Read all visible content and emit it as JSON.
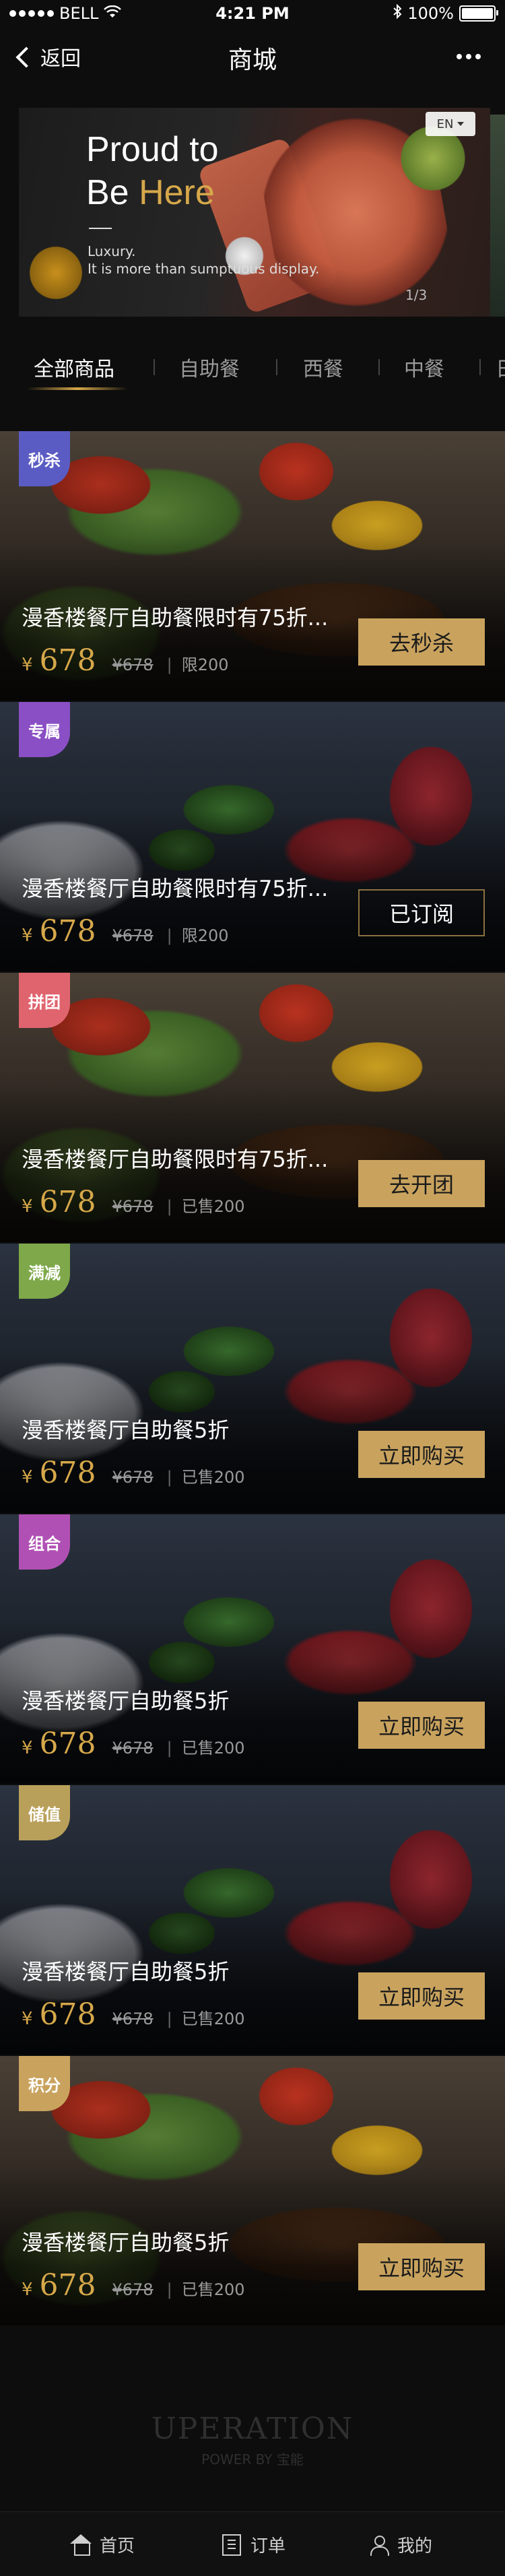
{
  "status_bar": {
    "carrier": "BELL",
    "time": "4:21 PM",
    "battery": "100%"
  },
  "nav": {
    "back_label": "返回",
    "title": "商城"
  },
  "banner": {
    "line1": "Proud to",
    "line2_a": "Be ",
    "line2_b": "Here",
    "sub1": "Luxury.",
    "sub2": "It is more than sumptuous display.",
    "pager": "1/3",
    "language": "EN"
  },
  "tabs": [
    "全部商品",
    "自助餐",
    "西餐",
    "中餐",
    "日"
  ],
  "products": [
    {
      "badge": "秒杀",
      "badge_color": "#5b5bc4",
      "name": "漫香楼餐厅自助餐限时有75折...",
      "currency": "¥",
      "price": "678",
      "original": "¥678",
      "info": "限200",
      "button": "去秒杀",
      "button_style": "filled",
      "image": "salad"
    },
    {
      "badge": "专属",
      "badge_color": "#8a4fc4",
      "name": "漫香楼餐厅自助餐限时有75折...",
      "currency": "¥",
      "price": "678",
      "original": "¥678",
      "info": "限200",
      "button": "已订阅",
      "button_style": "outline",
      "image": "lobster"
    },
    {
      "badge": "拼团",
      "badge_color": "#e0646e",
      "name": "漫香楼餐厅自助餐限时有75折...",
      "currency": "¥",
      "price": "678",
      "original": "¥678",
      "info": "已售200",
      "button": "去开团",
      "button_style": "filled",
      "image": "salad"
    },
    {
      "badge": "满减",
      "badge_color": "#7ea84a",
      "name": "漫香楼餐厅自助餐5折",
      "currency": "¥",
      "price": "678",
      "original": "¥678",
      "info": "已售200",
      "button": "立即购买",
      "button_style": "filled",
      "image": "lobster"
    },
    {
      "badge": "组合",
      "badge_color": "#b050b4",
      "name": "漫香楼餐厅自助餐5折",
      "currency": "¥",
      "price": "678",
      "original": "¥678",
      "info": "已售200",
      "button": "立即购买",
      "button_style": "filled",
      "image": "lobster"
    },
    {
      "badge": "储值",
      "badge_color": "#b9a05a",
      "name": "漫香楼餐厅自助餐5折",
      "currency": "¥",
      "price": "678",
      "original": "¥678",
      "info": "已售200",
      "button": "立即购买",
      "button_style": "filled",
      "image": "lobster"
    },
    {
      "badge": "积分",
      "badge_color": "#c9a35e",
      "name": "漫香楼餐厅自助餐5折",
      "currency": "¥",
      "price": "678",
      "original": "¥678",
      "info": "已售200",
      "button": "立即购买",
      "button_style": "filled",
      "image": "salad"
    }
  ],
  "footer": {
    "logo": "UPERATION",
    "powered": "POWER BY 宝能"
  },
  "tabbar": [
    {
      "label": "首页",
      "icon": "home-icon"
    },
    {
      "label": "订单",
      "icon": "order-icon"
    },
    {
      "label": "我的",
      "icon": "user-icon"
    }
  ]
}
